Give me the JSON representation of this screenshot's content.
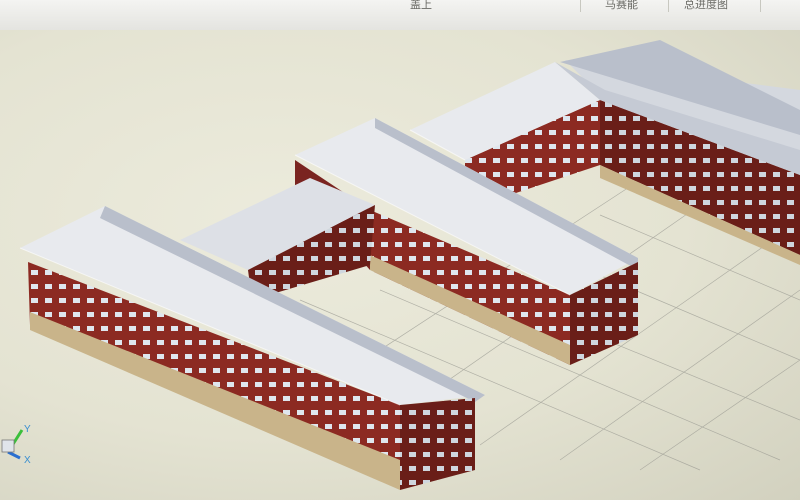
{
  "toolbar": {
    "items": [
      {
        "label": "盖上"
      },
      {
        "label": "马赛能"
      },
      {
        "label": "总进度图"
      }
    ]
  },
  "viewport": {
    "axis": {
      "y_label": "Y",
      "x_label": "X"
    }
  },
  "colors": {
    "brick": "#8c2a22",
    "brick_dark": "#6a1e18",
    "roof": "#e8eaee",
    "roof_side": "#b9bfcb",
    "wall_beige": "#c9b48a"
  }
}
